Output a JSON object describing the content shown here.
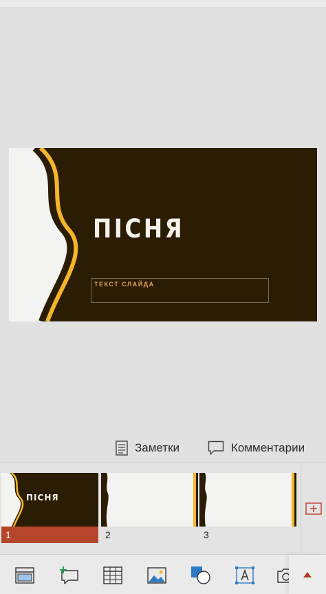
{
  "slide": {
    "title": "ПІСНЯ",
    "subtitle_placeholder": "ТЕКСТ СЛАЙДА"
  },
  "tools": {
    "notes_label": "Заметки",
    "comments_label": "Комментарии"
  },
  "thumbnails": [
    {
      "number": "1",
      "title": "ПІСНЯ",
      "selected": true
    },
    {
      "number": "2",
      "title": "",
      "selected": false
    },
    {
      "number": "3",
      "title": "",
      "selected": false
    }
  ],
  "toolbar": {
    "items": [
      "layout-icon",
      "new-comment-icon",
      "table-icon",
      "picture-icon",
      "shapes-icon",
      "text-box-icon",
      "camera-icon"
    ],
    "expand_icon": "caret-up-icon"
  },
  "colors": {
    "slide_background": "#2b1c04",
    "wave_accent": "#f3b52a",
    "wave_light": "#f3f3f1",
    "selected_thumbnail": "#b5452b",
    "subtitle_text": "#e8a35a",
    "add_slide_icon": "#c0392b",
    "expand_arrow": "#b53a2a"
  }
}
